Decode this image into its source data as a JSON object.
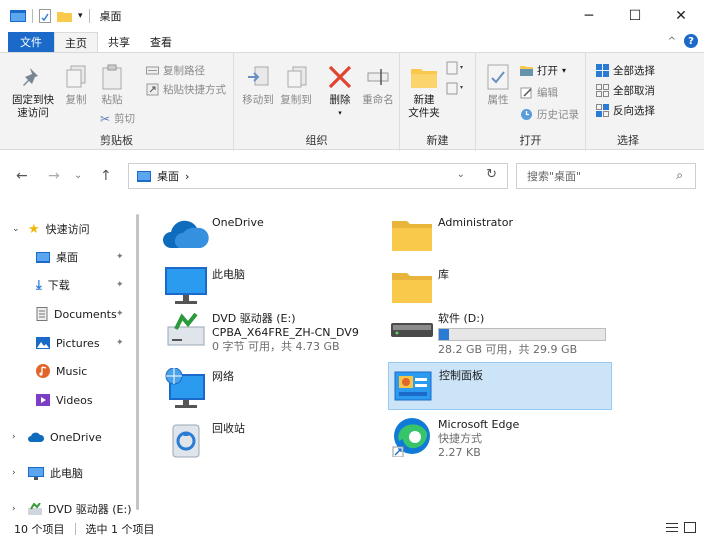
{
  "window": {
    "title": "桌面"
  },
  "tabs": {
    "file": "文件",
    "home": "主页",
    "share": "共享",
    "view": "查看"
  },
  "ribbon": {
    "clipboard": {
      "label": "剪贴板",
      "pin": "固定到快速访问",
      "pin_l1": "固定到快",
      "pin_l2": "速访问",
      "copy": "复制",
      "paste": "粘贴",
      "copy_path": "复制路径",
      "paste_shortcut": "粘贴快捷方式",
      "cut": "剪切"
    },
    "organize": {
      "label": "组织",
      "move_to": "移动到",
      "copy_to": "复制到",
      "delete": "删除",
      "rename": "重命名"
    },
    "new": {
      "label": "新建",
      "new_folder_l1": "新建",
      "new_folder_l2": "文件夹"
    },
    "open": {
      "label": "打开",
      "properties": "属性",
      "open": "打开",
      "edit": "编辑",
      "history": "历史记录"
    },
    "select": {
      "label": "选择",
      "select_all": "全部选择",
      "select_none": "全部取消",
      "invert": "反向选择"
    }
  },
  "address": {
    "path": "桌面",
    "search_placeholder": "搜索\"桌面\""
  },
  "sidebar": {
    "quick_access": "快速访问",
    "items": [
      "桌面",
      "下载",
      "Documents",
      "Pictures",
      "Music",
      "Videos"
    ],
    "onedrive": "OneDrive",
    "this_pc": "此电脑",
    "dvd": "DVD 驱动器 (E:)"
  },
  "main": {
    "onedrive": "OneDrive",
    "administrator": "Administrator",
    "this_pc": "此电脑",
    "library": "库",
    "dvd_name": "DVD 驱动器 (E:)",
    "dvd_label": "CPBA_X64FRE_ZH-CN_DV9",
    "dvd_space": "0 字节 可用，共 4.73 GB",
    "drive_d_name": "软件 (D:)",
    "drive_d_space": "28.2 GB 可用，共 29.9 GB",
    "drive_d_used_fraction": 0.06,
    "network": "网络",
    "control_panel": "控制面板",
    "recycle": "回收站",
    "edge_name": "Microsoft Edge",
    "edge_type": "快捷方式",
    "edge_size": "2.27 KB"
  },
  "status": {
    "count": "10 个项目",
    "selected": "选中 1 个项目"
  },
  "colors": {
    "accent": "#1b6ac9",
    "selection": "#cce4f7",
    "folder": "#f8c94a"
  }
}
